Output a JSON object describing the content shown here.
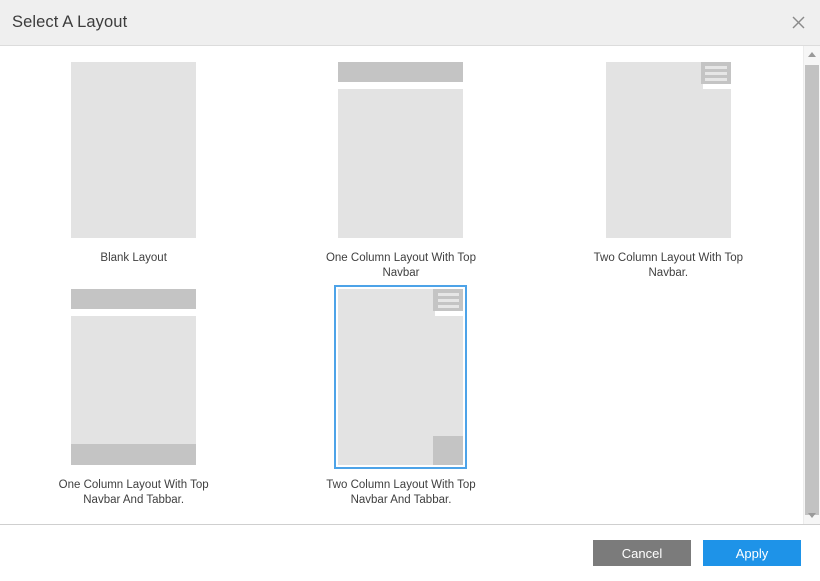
{
  "dialog": {
    "title": "Select A Layout",
    "close_icon": "close-icon"
  },
  "layouts": [
    {
      "id": "blank-layout",
      "label": "Blank Layout",
      "selected": false,
      "parts": [
        "content-full"
      ]
    },
    {
      "id": "one-column-top-navbar",
      "label": "One Column Layout With Top Navbar",
      "selected": false,
      "parts": [
        "navbar",
        "content"
      ]
    },
    {
      "id": "two-column-top-navbar",
      "label": "Two Column Layout With Top Navbar.",
      "selected": false,
      "parts": [
        "left-column",
        "hamburger",
        "right-column"
      ]
    },
    {
      "id": "one-column-top-navbar-tabbar",
      "label": "One Column Layout With Top Navbar And Tabbar.",
      "selected": false,
      "parts": [
        "navbar",
        "content",
        "tabbar"
      ]
    },
    {
      "id": "two-column-top-navbar-tabbar",
      "label": "Two Column Layout With Top Navbar And Tabbar.",
      "selected": true,
      "parts": [
        "left-column",
        "hamburger",
        "right-column",
        "right-tabbar"
      ]
    }
  ],
  "scrollbar": {
    "up_icon": "scroll-up-arrow-icon",
    "down_icon": "scroll-down-arrow-icon"
  },
  "footer": {
    "cancel_label": "Cancel",
    "apply_label": "Apply"
  },
  "colors": {
    "accent": "#1e93e8",
    "selection_border": "#4da3e8",
    "cancel_button": "#7b7b7b",
    "block_light": "#e3e3e3",
    "block_dark": "#c4c4c4",
    "header_bg": "#efefef"
  }
}
